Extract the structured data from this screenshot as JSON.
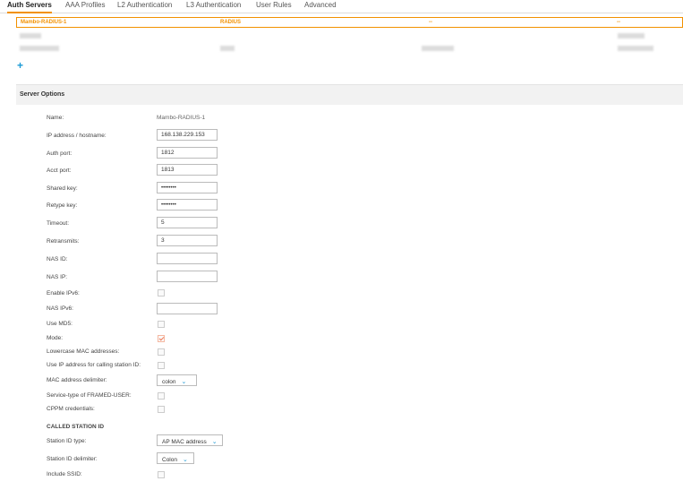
{
  "tabs": [
    "Auth Servers",
    "AAA Profiles",
    "L2 Authentication",
    "L3 Authentication",
    "User Rules",
    "Advanced"
  ],
  "servers": {
    "selected": {
      "name": "Mambo-RADIUS-1",
      "type": "RADIUS",
      "col3": "--",
      "col4": "--"
    }
  },
  "add_label": "+",
  "section_title": "Server Options",
  "form": {
    "name_label": "Name:",
    "name_value": "Mambo-RADIUS-1",
    "ip_label": "IP address / hostname:",
    "ip_value": "168.138.229.153",
    "auth_port_label": "Auth port:",
    "auth_port_value": "1812",
    "acct_port_label": "Acct port:",
    "acct_port_value": "1813",
    "shared_key_label": "Shared key:",
    "shared_key_value": "••••••••",
    "retype_key_label": "Retype key:",
    "retype_key_value": "••••••••",
    "timeout_label": "Timeout:",
    "timeout_value": "5",
    "retransmits_label": "Retransmits:",
    "retransmits_value": "3",
    "nas_id_label": "NAS ID:",
    "nas_id_value": "",
    "nas_ip_label": "NAS IP:",
    "nas_ip_value": "",
    "enable_ipv6_label": "Enable IPv6:",
    "nas_ipv6_label": "NAS IPv6:",
    "nas_ipv6_value": "",
    "use_md5_label": "Use MD5:",
    "mode_label": "Mode:",
    "lowercase_mac_label": "Lowercase MAC addresses:",
    "use_ip_label": "Use IP address for calling station ID:",
    "mac_delim_label": "MAC address delimiter:",
    "mac_delim_value": "colon",
    "service_type_label": "Service-type of FRAMED-USER:",
    "cppm_label": "CPPM credentials:"
  },
  "called_station": {
    "header": "CALLED STATION ID",
    "id_type_label": "Station ID type:",
    "id_type_value": "AP MAC address",
    "delim_label": "Station ID delimiter:",
    "delim_value": "Colon",
    "include_ssid_label": "Include SSID:"
  },
  "checkbox_states": {
    "enable_ipv6": false,
    "use_md5": false,
    "mode": true,
    "lowercase_mac": false,
    "use_ip": false,
    "service_type": false,
    "cppm": false,
    "include_ssid": false
  },
  "colors": {
    "accent": "#f29100",
    "link": "#1b9ad6"
  }
}
